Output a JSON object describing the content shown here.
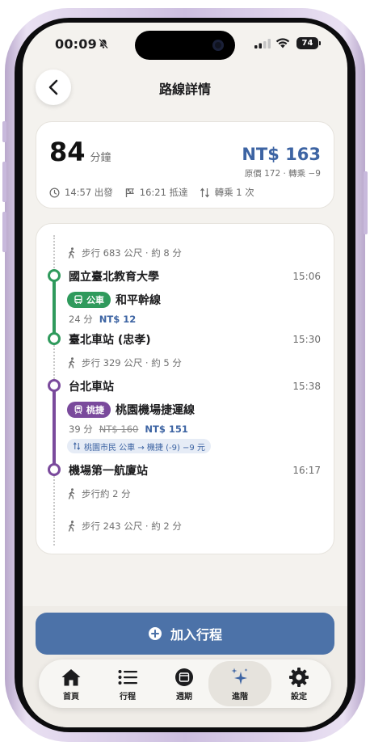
{
  "status": {
    "time": "00:09",
    "battery": "74"
  },
  "header": {
    "title": "路線詳情"
  },
  "summary": {
    "duration_value": "84",
    "duration_unit": "分鐘",
    "price": "NT$ 163",
    "price_note": "原價 172 · 轉乘 −9",
    "depart": "14:57 出發",
    "arrive": "16:21 抵達",
    "transfers": "轉乘 1 次"
  },
  "route": {
    "walk1": "步行 683 公尺 · 約 8 分",
    "stop1": {
      "name": "國立臺北教育大學",
      "time": "15:06"
    },
    "leg1": {
      "mode": "公車",
      "line": "和平幹線",
      "minutes": "24 分",
      "fare": "NT$ 12",
      "color": "#2f9a5c"
    },
    "stop2": {
      "name": "臺北車站 (忠孝)",
      "time": "15:30"
    },
    "walk2": "步行 329 公尺 · 約 5 分",
    "stop3": {
      "name": "台北車站",
      "time": "15:38"
    },
    "leg2": {
      "mode": "桃捷",
      "line": "桃園機場捷運線",
      "minutes": "39 分",
      "fare_original": "NT$ 160",
      "fare": "NT$ 151",
      "color": "#7a4a9c",
      "discount": "桃園市民 公車 → 機捷 (-9) −9 元"
    },
    "stop4": {
      "name": "機場第一航廈站",
      "time": "16:17"
    },
    "walk3": "步行約 2 分",
    "walk4": "步行 243 公尺 · 約 2 分"
  },
  "actions": {
    "add_label": "加入行程"
  },
  "tabs": [
    {
      "label": "首頁",
      "icon": "home-icon"
    },
    {
      "label": "行程",
      "icon": "list-icon"
    },
    {
      "label": "週期",
      "icon": "calendar-icon"
    },
    {
      "label": "進階",
      "icon": "sparkles-icon",
      "active": true
    },
    {
      "label": "設定",
      "icon": "gear-icon"
    }
  ]
}
